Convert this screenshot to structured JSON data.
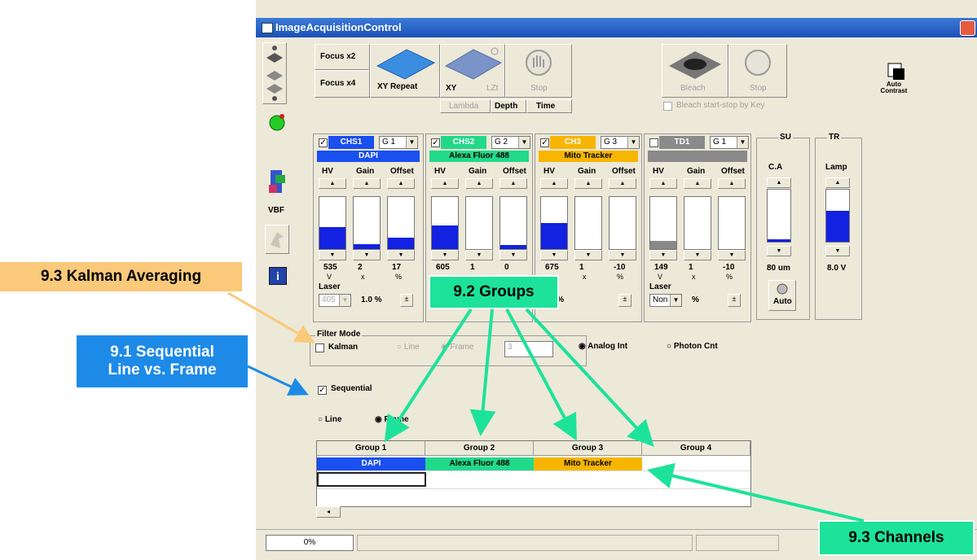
{
  "window": {
    "title": "ImageAcquisitionControl"
  },
  "scan_buttons": {
    "focus_x2": "Focus x2",
    "focus_x4": "Focus x4",
    "xy_repeat": "XY Repeat",
    "xy": "XY",
    "lzt": "LZt",
    "stop": "Stop",
    "lambda": "Lambda",
    "depth": "Depth",
    "time": "Time"
  },
  "bleach": {
    "bleach": "Bleach",
    "stop": "Stop",
    "start_stop_key": "Bleach start-stop by Key"
  },
  "auto_contrast": "Auto\nContrast",
  "vbf": "VBF",
  "slider_labels": {
    "hv": "HV",
    "gain": "Gain",
    "offset": "Offset"
  },
  "channels": [
    {
      "name": "CHS1",
      "group": "G 1",
      "dye": "DAPI",
      "color": "#1a4ff0",
      "hv": "535",
      "hv_unit": "V",
      "gain": "2",
      "gain_unit": "x",
      "offset": "17",
      "offset_unit": "%",
      "hv_level": 0.42,
      "gain_level": 0.1,
      "offset_level": 0.22,
      "laser_label": "Laser",
      "laser_wl": "405",
      "laser_pct": "1.0 %",
      "checked": true
    },
    {
      "name": "CHS2",
      "group": "G 2",
      "dye": "Alexa Fluor 488",
      "color": "#22d98a",
      "hv": "605",
      "hv_unit": "",
      "gain": "1",
      "gain_unit": "",
      "offset": "0",
      "offset_unit": "",
      "hv_level": 0.45,
      "gain_level": 0,
      "offset_level": 0.08,
      "checked": true
    },
    {
      "name": "CH3",
      "group": "G 3",
      "dye": "Mito Tracker",
      "color": "#f7b500",
      "hv": "675",
      "hv_unit": "",
      "gain": "1",
      "gain_unit": "x",
      "offset": "-10",
      "offset_unit": "%",
      "hv_level": 0.5,
      "gain_level": 0,
      "offset_level": 0,
      "laser_pct": "21.0 %",
      "checked": true
    },
    {
      "name": "TD1",
      "group": "G 1",
      "dye": "",
      "color": "#8a8a8a",
      "hv": "149",
      "hv_unit": "V",
      "gain": "1",
      "gain_unit": "x",
      "offset": "-10",
      "offset_unit": "%",
      "hv_level": 0.15,
      "gain_level": 0,
      "offset_level": 0,
      "laser_label": "Laser",
      "laser_wl": "Non",
      "laser_pct": "%",
      "checked": false
    }
  ],
  "su": {
    "title": "SU",
    "label": "C.A",
    "value": "80 um",
    "level": 0.05,
    "auto": "Auto"
  },
  "tr": {
    "title": "TR",
    "label": "Lamp",
    "value": "8.0 V",
    "level": 0.6
  },
  "filter_mode": {
    "title": "Filter Mode",
    "kalman": "Kalman",
    "line": "Line",
    "frame": "Frame",
    "count": "3",
    "analog": "Analog Int",
    "photon": "Photon Cnt"
  },
  "sequential": {
    "label": "Sequential",
    "line": "Line",
    "frame": "Frame"
  },
  "groups_table": {
    "headers": [
      "Group 1",
      "Group 2",
      "Group 3",
      "Group 4"
    ],
    "row1": [
      "DAPI",
      "Alexa Fluor 488",
      "Mito Tracker",
      ""
    ]
  },
  "status": {
    "progress": "0%"
  },
  "callouts": {
    "kalman": "9.3 Kalman Averaging",
    "sequential": "9.1 Sequential\nLine vs. Frame",
    "groups": "9.2 Groups",
    "channels": "9.3 Channels"
  }
}
